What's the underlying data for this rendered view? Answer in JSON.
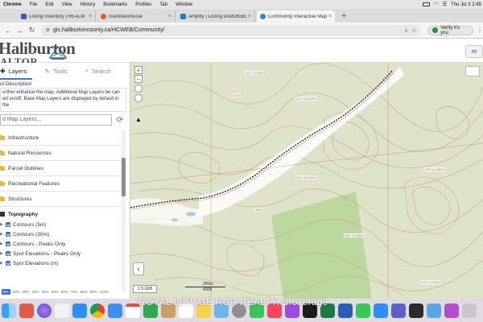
{
  "menubar": {
    "app": "Chrome",
    "items": [
      "File",
      "Edit",
      "View",
      "History",
      "Bookmarks",
      "Profiles",
      "Tab",
      "Window"
    ],
    "datetime": "Thu Jul 3  2:45"
  },
  "tabs": [
    {
      "label": "Listing Inventory | REALM",
      "color": "#3a5ba8"
    },
    {
      "label": "GeoWarehouse",
      "color": "#e8572b"
    },
    {
      "label": "Amplify | Listing Draft26583",
      "color": "#1e7ad1"
    },
    {
      "label": "Community Interactive Mapp",
      "color": "#3a7bd5",
      "active": true
    }
  ],
  "address": {
    "url": "gis.haliburtoncounty.ca/HCWEB/Community/",
    "verify_label": "Verify it's you"
  },
  "header": {
    "logo_top": "Haliburton",
    "logo_bottom": "ALTOR",
    "right_button": "m"
  },
  "sidebar": {
    "tabs": [
      {
        "label": "Layers",
        "icon": "layers-icon",
        "active": true
      },
      {
        "label": "Tools",
        "icon": "tools-icon"
      },
      {
        "label": "Search",
        "icon": "search-icon"
      }
    ],
    "tool_title": "ol Description",
    "tool_desc": "urther enhance the map, Additional Map Layers be can ed on/off. Base Map Layers are displayed by default in the",
    "search_placeholder": "d Map Layers...",
    "layers": [
      "Infrastructure",
      "Natural Resources",
      "Parcel Outlines",
      "Recreational Features",
      "Structures"
    ],
    "topography": {
      "title": "Topography",
      "items": [
        "Contours (5m)",
        "Contours (30m)",
        "Contours - Peaks Only",
        "Spot Elevations - Peaks Only",
        "Spot Elevations (m)"
      ]
    },
    "opacity": [
      "0%",
      "10%",
      "20%",
      "30%",
      "40%",
      "50%",
      "60%",
      "70%",
      "80%",
      "90%",
      "100%"
    ]
  },
  "map": {
    "scale_ratio": "1:5,028",
    "scale_m": "280m",
    "scale_ft": "400ft",
    "labels": [
      {
        "text": "LOT 1 CON 5"
      },
      {
        "text": "413"
      },
      {
        "text": "LOT 2 CON 5"
      },
      {
        "text": "398"
      },
      {
        "text": "LOT 3 CON 4"
      },
      {
        "text": "LOT 4 CON 4"
      },
      {
        "text": "LOT 2 CON 4"
      },
      {
        "text": "LOT 3 CON 4"
      }
    ]
  },
  "dock": {
    "watermark": "ROYAL LEPAGE RCR REALTY, Brokerage"
  }
}
